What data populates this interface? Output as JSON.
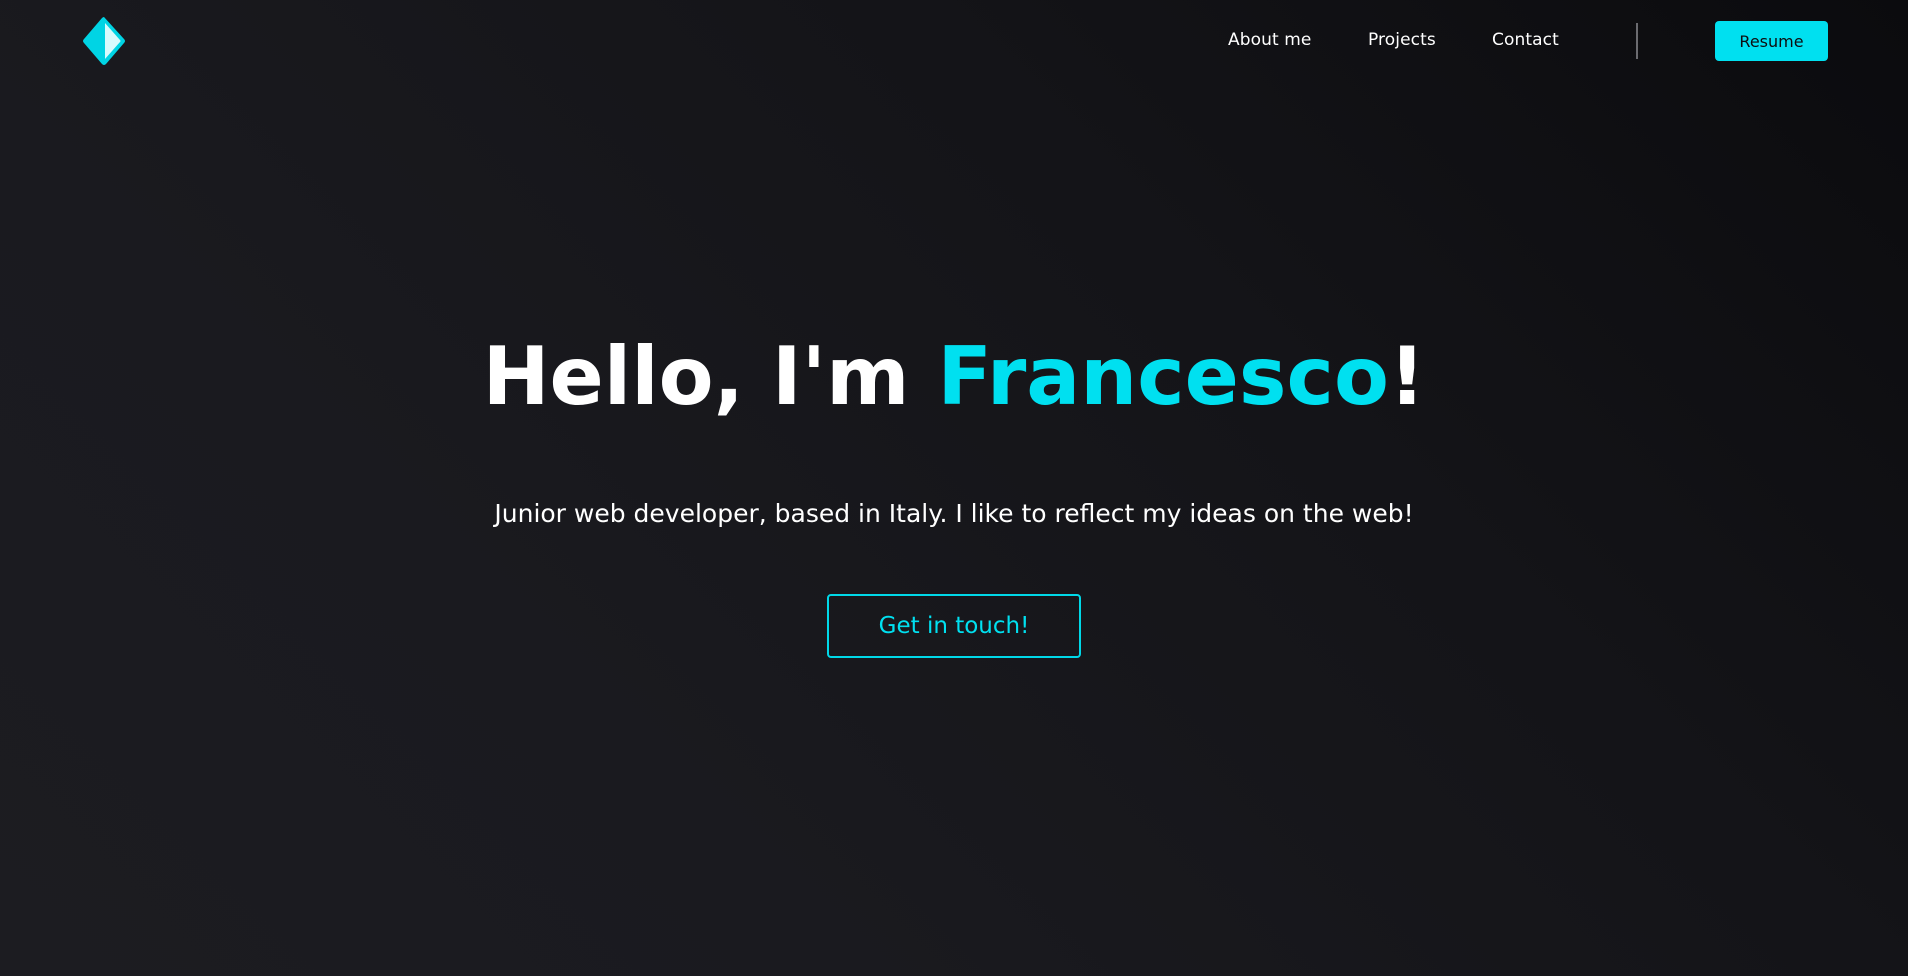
{
  "brand": {
    "logo_icon": "diamond-logo-icon",
    "accent_color": "#00e0f0",
    "background_color": "#1a1a1f"
  },
  "nav": {
    "items": [
      {
        "label": "About me"
      },
      {
        "label": "Projects"
      },
      {
        "label": "Contact"
      }
    ],
    "resume_label": "Resume"
  },
  "hero": {
    "title_prefix": "Hello, I'm ",
    "title_name": "Francesco",
    "title_suffix": "!",
    "subtitle": "Junior web developer, based in Italy. I like to reflect my ideas on the web!",
    "cta_label": "Get in touch!"
  }
}
